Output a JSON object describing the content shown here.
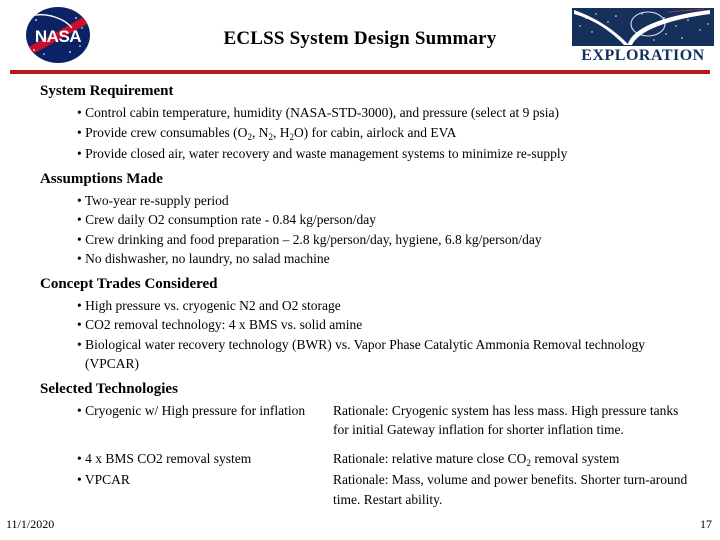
{
  "header": {
    "title": "ECLSS System Design Summary",
    "nasa_logo_alt": "NASA",
    "exploration_logo_word": "EXPLORATION",
    "rule_color": "#b51b1b",
    "nasa_navy": "#0b2265",
    "nasa_red": "#c8102e",
    "exploration_navy": "#16305c"
  },
  "sections": [
    {
      "heading": "System Requirement",
      "bullets": [
        "• Control cabin temperature, humidity (NASA-STD-3000), and pressure (select at 9 psia)",
        "• Provide crew consumables (O2, N2, H2O) for cabin, airlock and EVA",
        "• Provide closed air, water recovery and waste management systems to minimize re-supply"
      ]
    },
    {
      "heading": "Assumptions Made",
      "bullets": [
        "• Two-year re-supply period",
        "• Crew daily O2 consumption rate - 0.84 kg/person/day",
        "• Crew drinking and food preparation – 2.8 kg/person/day, hygiene, 6.8 kg/person/day",
        "• No dishwasher, no laundry, no salad machine"
      ]
    },
    {
      "heading": "Concept Trades Considered",
      "bullets": [
        "• High pressure vs. cryogenic N2 and O2 storage",
        "• CO2 removal technology: 4 x BMS vs. solid amine",
        "• Biological water recovery technology (BWR) vs. Vapor Phase Catalytic Ammonia Removal technology (VPCAR)"
      ]
    }
  ],
  "selected_technologies": {
    "heading": "Selected Technologies",
    "rows": [
      {
        "technology": "• Cryogenic w/ High pressure for inflation",
        "rationale": "Rationale: Cryogenic system has less mass.  High pressure tanks for initial Gateway inflation for shorter inflation time."
      },
      {
        "technology": "• 4 x BMS CO2 removal system",
        "rationale_prefix": "Rationale: relative mature close CO",
        "rationale_sub": "2",
        "rationale_suffix": " removal system"
      },
      {
        "technology": "• VPCAR",
        "rationale": "Rationale: Mass, volume and power benefits.  Shorter turn-around time.  Restart ability."
      }
    ]
  },
  "footer": {
    "date": "11/1/2020",
    "page_number": "17"
  }
}
